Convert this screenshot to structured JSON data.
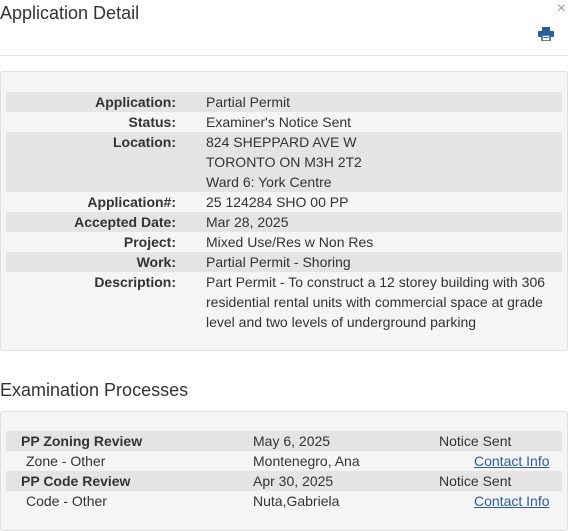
{
  "header": {
    "title": "Application Detail",
    "close_label": "×",
    "print_icon": "print-icon"
  },
  "detail": {
    "application_label": "Application:",
    "application": "Partial Permit",
    "status_label": "Status:",
    "status": "Examiner's Notice Sent",
    "location_label": "Location:",
    "location_line1": "824 SHEPPARD AVE W",
    "location_line2": "TORONTO ON M3H 2T2",
    "location_line3": "Ward 6: York Centre",
    "appnum_label": "Application#:",
    "appnum": "25 124284 SHO 00 PP",
    "accepted_label": "Accepted Date:",
    "accepted": "Mar 28, 2025",
    "project_label": "Project:",
    "project": "Mixed Use/Res w Non Res",
    "work_label": "Work:",
    "work": "Partial Permit - Shoring",
    "description_label": "Description:",
    "description": "Part Permit - To construct a 12 storey building with 306 residential rental units with commercial space at grade level and two levels of underground parking"
  },
  "processes": {
    "title": "Examination Processes",
    "rows": [
      {
        "name": "PP Zoning Review",
        "date": "May 6, 2025",
        "status": "Notice Sent"
      },
      {
        "name": "Zone - Other",
        "examiner": "Montenegro, Ana",
        "link": "Contact Info"
      },
      {
        "name": "PP Code Review",
        "date": "Apr 30, 2025",
        "status": "Notice Sent"
      },
      {
        "name": "Code - Other",
        "examiner": "Nuta,Gabriela",
        "link": "Contact Info"
      }
    ]
  }
}
